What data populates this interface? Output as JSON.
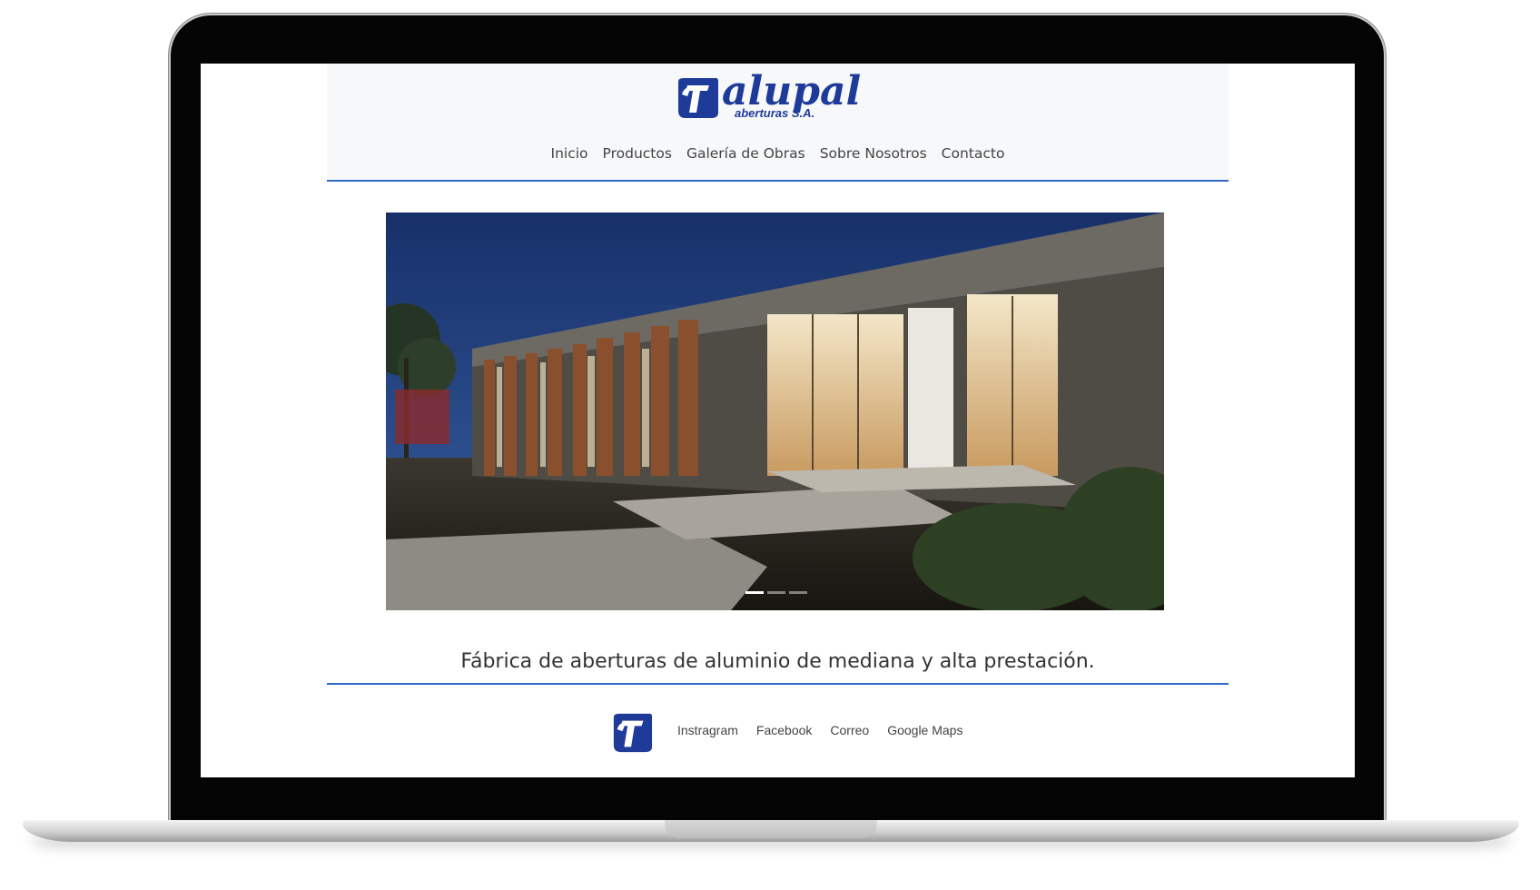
{
  "brand": {
    "name": "alupal",
    "subtitle": "aberturas S.A.",
    "color": "#1f3b9a",
    "accent_rule_color": "#2e67c2"
  },
  "nav": {
    "items": [
      "Inicio",
      "Productos",
      "Galería de Obras",
      "Sobre Nosotros",
      "Contacto"
    ]
  },
  "hero": {
    "image": "modern concrete house at dusk with wooden slats and lit glass windows",
    "slides": 3,
    "active_slide": 1
  },
  "tagline": "Fábrica de aberturas de aluminio de mediana y alta prestación.",
  "footer": {
    "logo_icon": "alupal-mark-icon",
    "links": [
      "Instragram",
      "Facebook",
      "Correo",
      "Google Maps"
    ]
  }
}
